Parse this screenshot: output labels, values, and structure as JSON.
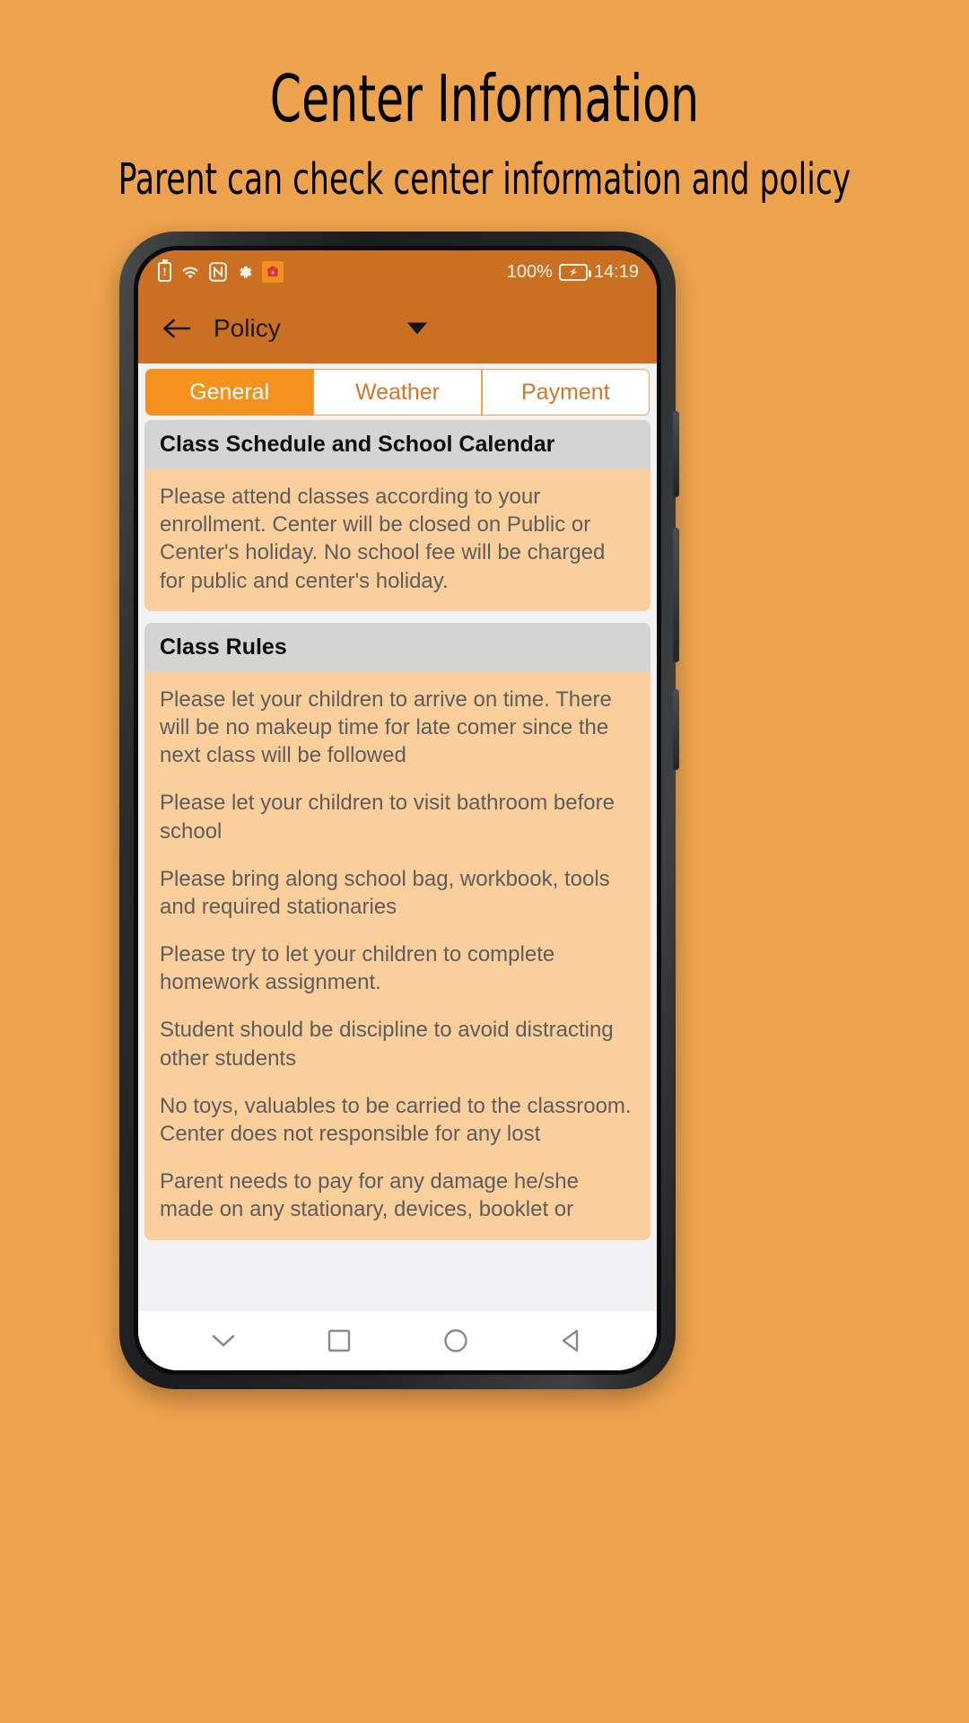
{
  "promo": {
    "title": "Center Information",
    "subtitle": "Parent can check center information and policy"
  },
  "colors": {
    "page_background": "#eda24d",
    "app_bar": "#cb6f22",
    "tab_active": "#f5921e",
    "card_header": "#d4d4d4",
    "card_body": "#fbcf9c",
    "body_text": "#5d5d5d"
  },
  "status_bar": {
    "icons": [
      "battery-alert-icon",
      "wifi-icon",
      "nfc-icon",
      "gear-icon",
      "app-badge-icon"
    ],
    "battery_percent": "100%",
    "battery_icon": "battery-charging-icon",
    "time": "14:19"
  },
  "app_bar": {
    "back_icon": "back-arrow-icon",
    "title": "Policy",
    "dropdown_icon": "chevron-down-icon"
  },
  "tabs": [
    {
      "label": "General",
      "active": true
    },
    {
      "label": "Weather",
      "active": false
    },
    {
      "label": "Payment",
      "active": false
    }
  ],
  "sections": [
    {
      "title": "Class Schedule and School Calendar",
      "paragraphs": [
        "Please attend classes according to your enrollment. Center will be closed on Public or Center's holiday.  No school fee will be charged for public and center's holiday."
      ]
    },
    {
      "title": "Class Rules",
      "paragraphs": [
        "Please let your children to arrive on time. There will be no makeup time for late comer since the next class will be followed",
        "Please let your children to visit bathroom before school",
        "Please bring along school bag, workbook, tools and required stationaries",
        "Please try to let your children to complete homework assignment.",
        "Student should be discipline to avoid distracting other students",
        "No toys, valuables to be carried to the classroom.  Center does not responsible for any lost",
        "Parent needs to pay for any damage he/she made on any stationary, devices, booklet or"
      ]
    }
  ],
  "nav_bar": {
    "buttons": [
      "chevron-down-icon",
      "recents-square-icon",
      "home-circle-icon",
      "back-triangle-icon"
    ]
  }
}
